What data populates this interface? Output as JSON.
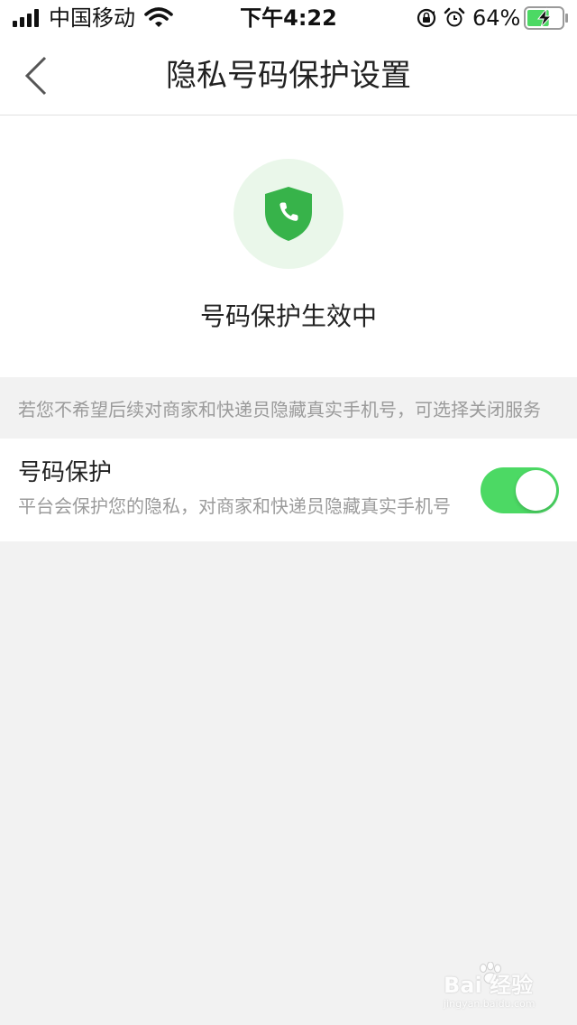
{
  "status_bar": {
    "carrier": "中国移动",
    "time": "下午4:22",
    "battery_percent": "64%",
    "battery_level": 0.64,
    "icons": [
      "signal-icon",
      "wifi-icon",
      "rotation-lock-icon",
      "alarm-icon",
      "battery-charging-icon"
    ]
  },
  "nav": {
    "title": "隐私号码保护设置",
    "back_icon": "chevron-left-icon"
  },
  "hero": {
    "icon": "shield-phone-icon",
    "status_text": "号码保护生效中"
  },
  "hint": {
    "text": "若您不希望后续对商家和快递员隐藏真实手机号，可选择关闭服务"
  },
  "setting": {
    "title": "号码保护",
    "description": "平台会保护您的隐私，对商家和快递员隐藏真实手机号",
    "enabled": true
  },
  "watermark": {
    "text": "Bai 经验",
    "url": "jingyan.baidu.com"
  },
  "colors": {
    "accent_green": "#4cd964",
    "shield_green": "#37b34a",
    "circle_bg": "#eaf7ea",
    "page_bg": "#f2f2f2",
    "hint_gray": "#9b9b9b"
  }
}
